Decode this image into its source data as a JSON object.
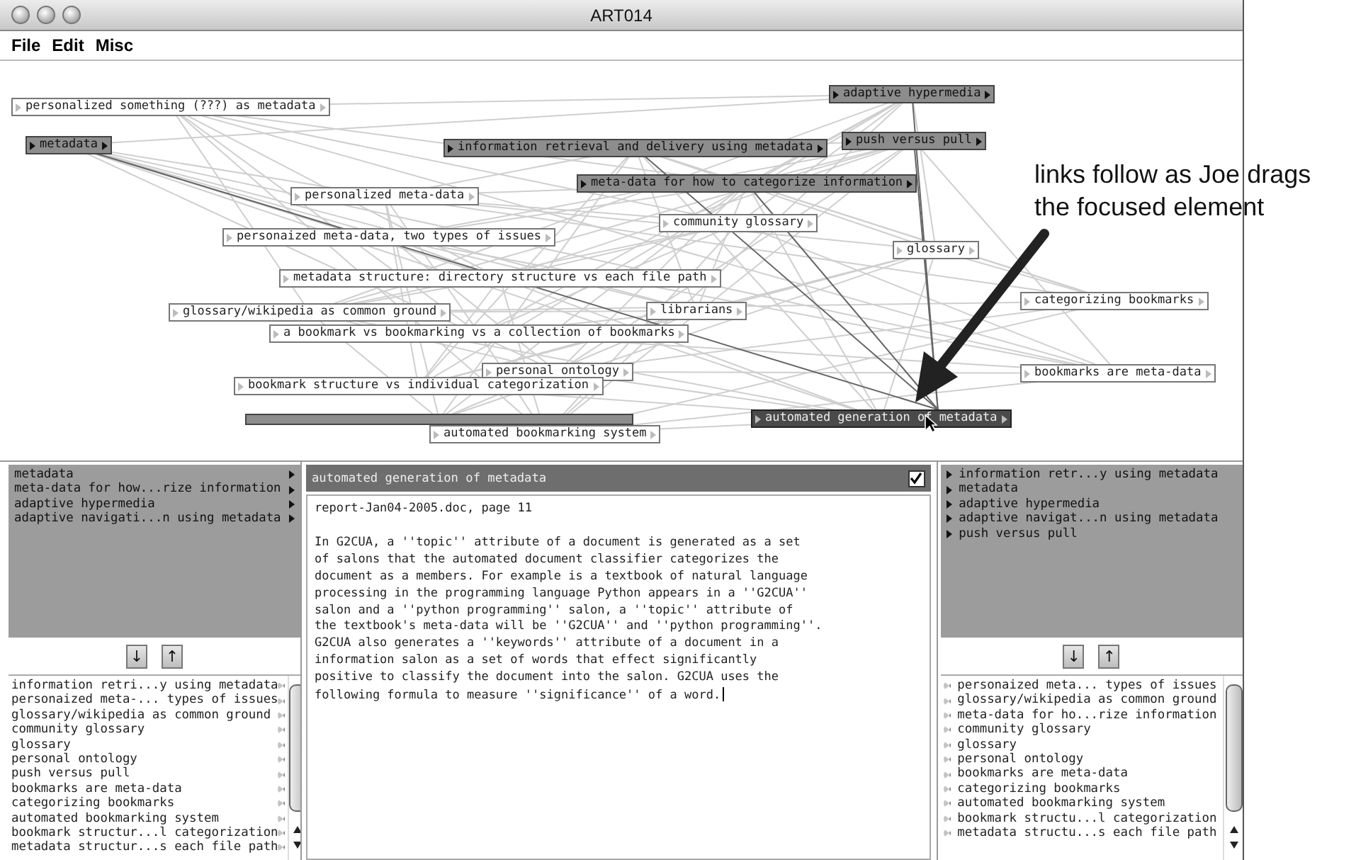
{
  "window": {
    "title": "ART014"
  },
  "menu": [
    "File",
    "Edit",
    "Misc"
  ],
  "graph": {
    "nodes": [
      {
        "label": "personalized something (???) as metadata",
        "kind": "plain"
      },
      {
        "label": "metadata",
        "kind": "linked"
      },
      {
        "label": "information retrieval and delivery using metadata",
        "kind": "linked"
      },
      {
        "label": "adaptive hypermedia",
        "kind": "linked"
      },
      {
        "label": "push versus pull",
        "kind": "linked"
      },
      {
        "label": "meta-data for how to categorize information",
        "kind": "linked"
      },
      {
        "label": "personalized meta-data",
        "kind": "plain"
      },
      {
        "label": "community glossary",
        "kind": "plain"
      },
      {
        "label": "personaized meta-data, two types of issues",
        "kind": "plain"
      },
      {
        "label": "glossary",
        "kind": "plain"
      },
      {
        "label": "metadata structure: directory structure vs each file path",
        "kind": "plain"
      },
      {
        "label": "categorizing bookmarks",
        "kind": "plain"
      },
      {
        "label": "glossary/wikipedia as common ground",
        "kind": "plain"
      },
      {
        "label": "librarians",
        "kind": "plain"
      },
      {
        "label": "a bookmark vs bookmarking vs a collection of bookmarks",
        "kind": "plain"
      },
      {
        "label": "personal ontology",
        "kind": "plain"
      },
      {
        "label": "bookmark structure vs individual categorization",
        "kind": "plain"
      },
      {
        "label": "bookmarks are meta-data",
        "kind": "plain"
      },
      {
        "kind": "obscured"
      },
      {
        "label": "automated bookmarking system",
        "kind": "plain"
      },
      {
        "label": "automated generation of metadata",
        "kind": "focused"
      }
    ]
  },
  "left_panel": {
    "upper": [
      "metadata",
      "meta-data for how...rize information",
      "adaptive hypermedia",
      "adaptive navigati...n using metadata"
    ],
    "buttons": [
      "↓",
      "↑"
    ],
    "lower": [
      "information retri...y using metadata",
      "personaized meta-... types of issues",
      "glossary/wikipedia as common ground",
      "community glossary",
      "glossary",
      "personal ontology",
      "push versus pull",
      "bookmarks are meta-data",
      "categorizing bookmarks",
      "automated bookmarking system",
      "bookmark structur...l categorization",
      "metadata structur...s each file path"
    ]
  },
  "editor": {
    "title": "automated generation of metadata",
    "checked": true,
    "source": "report-Jan04-2005.doc, page 11",
    "body": "In G2CUA, a ''topic'' attribute of a document is generated as a set\nof salons that the automated document classifier categorizes the\ndocument as a members. For example is a textbook of natural language\nprocessing in the programming language Python appears in a ''G2CUA''\nsalon and a ''python programming'' salon, a ''topic'' attribute of\nthe textbook's meta-data will be ''G2CUA'' and ''python programming''.\nG2CUA also generates a ''keywords'' attribute of a document in a\ninformation salon as a set of words that effect significantly\npositive to classify the document into the salon. G2CUA uses the\nfollowing formula to measure ''significance'' of a word."
  },
  "right_panel": {
    "upper": [
      "information retr...y using metadata",
      "metadata",
      "adaptive hypermedia",
      "adaptive navigat...n using metadata",
      "push versus pull"
    ],
    "buttons": [
      "↓",
      "↑"
    ],
    "lower": [
      "personaized meta... types of issues",
      "glossary/wikipedia as common ground",
      "meta-data for ho...rize information",
      "community glossary",
      "glossary",
      "personal ontology",
      "bookmarks are meta-data",
      "categorizing bookmarks",
      "automated bookmarking system",
      "bookmark structu...l categorization",
      "metadata structu...s each file path"
    ]
  },
  "annotation": "links follow as Joe drags\nthe focused element"
}
